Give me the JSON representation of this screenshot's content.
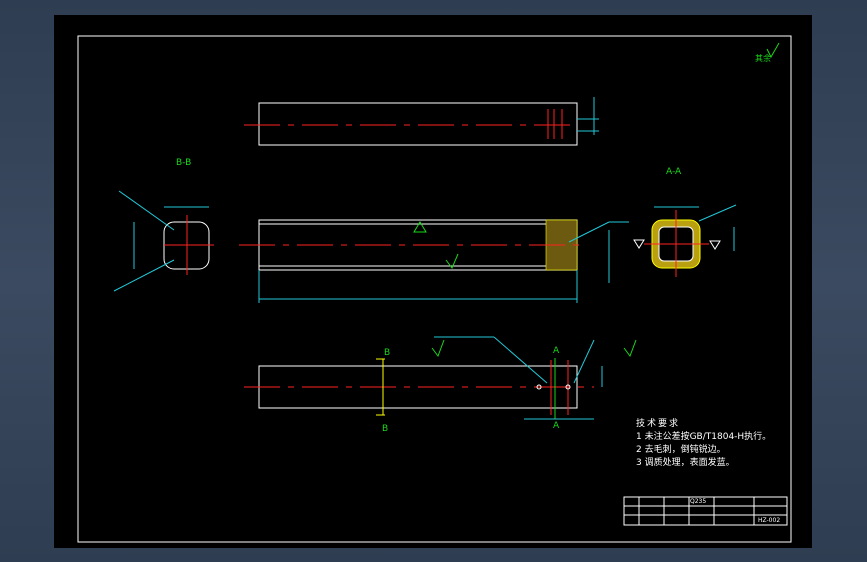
{
  "section_labels": {
    "bb": "B-B",
    "aa": "A-A",
    "b_top": "B",
    "b_bottom": "B",
    "a_top": "A",
    "a_bottom": "A"
  },
  "tech_requirements": {
    "title": "技术要求",
    "items": [
      "1 未注公差按GB/T1804-H执行。",
      "2 去毛刺，倒钝锐边。",
      "3 调质处理，表面发蓝。"
    ]
  },
  "title_block": {
    "material": "Q235",
    "drawing_no": "HZ-002"
  },
  "colors": {
    "sheet": "#000000",
    "outline": "#ffffff",
    "centerline": "#ff2222",
    "dimension": "#22c8d8",
    "section_mark": "#19d819",
    "hatch": "#ffff00"
  }
}
